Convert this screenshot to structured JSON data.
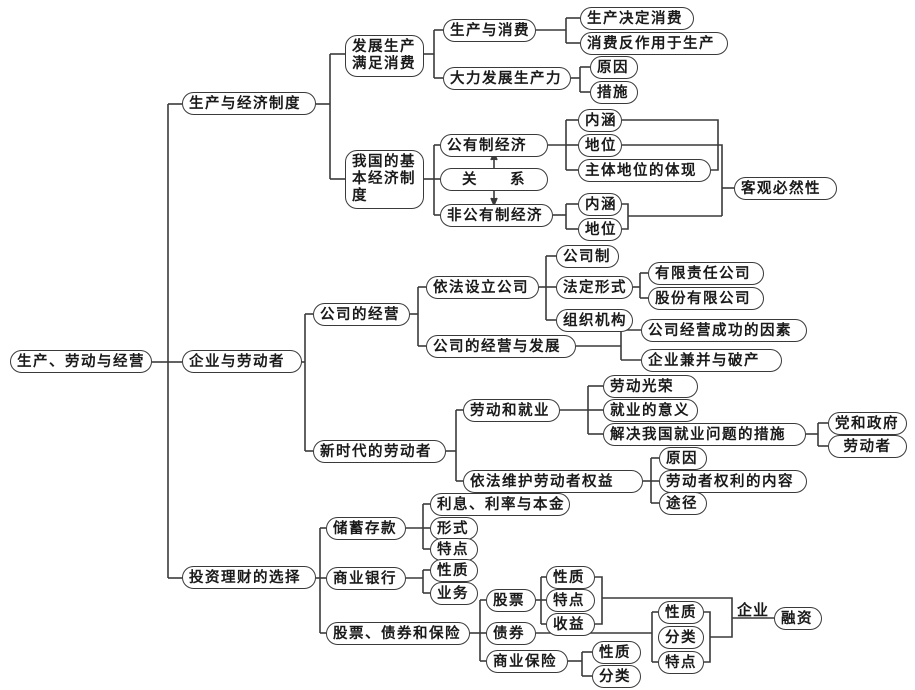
{
  "root": "生产、劳动与经营",
  "l1": {
    "production": "生产与经济制度",
    "enterprise": "企业与劳动者",
    "investment": "投资理财的选择"
  },
  "production": {
    "develop": "发展生产满足消费",
    "basic_system": "我国的基本经济制度",
    "prod_consume": "生产与消费",
    "prod_decides": "生产决定消费",
    "consume_reacts": "消费反作用于生产",
    "develop_force": "大力发展生产力",
    "reason": "原因",
    "measures": "措施",
    "public": "公有制经济",
    "relation": "关　　系",
    "nonpublic": "非公有制经济",
    "public_meaning": "内涵",
    "public_status": "地位",
    "main_status": "主体地位的体现",
    "nonpublic_meaning": "内涵",
    "nonpublic_status": "地位",
    "necessity": "客观必然性"
  },
  "enterprise": {
    "company_ops": "公司的经营",
    "new_worker": "新时代的劳动者",
    "establish": "依法设立公司",
    "company_system": "公司制",
    "legal_form": "法定形式",
    "llc": "有限责任公司",
    "joint_stock": "股份有限公司",
    "org": "组织机构",
    "ops_dev": "公司的经营与发展",
    "success": "公司经营成功的因素",
    "merger": "企业兼并与破产",
    "labor_employment": "劳动和就业",
    "labor_glory": "劳动光荣",
    "employment_meaning": "就业的意义",
    "solve_employment": "解决我国就业问题的措施",
    "party_gov": "党和政府",
    "workers": "劳动者",
    "rights": "依法维护劳动者权益",
    "rights_reason": "原因",
    "rights_content": "劳动者权利的内容",
    "rights_way": "途径"
  },
  "investment": {
    "savings": "储蓄存款",
    "bank": "商业银行",
    "securities": "股票、债券和保险",
    "interest": "利息、利率与本金",
    "form": "形式",
    "feature": "特点",
    "bank_nature": "性质",
    "bank_business": "业务",
    "stock": "股票",
    "bond": "债券",
    "insurance": "商业保险",
    "stock_nature": "性质",
    "stock_feature": "特点",
    "stock_income": "收益",
    "bond_nature": "性质",
    "bond_type": "分类",
    "bond_feature": "特点",
    "ins_nature": "性质",
    "ins_type": "分类",
    "enterprise_label": "企业",
    "financing": "融资"
  }
}
